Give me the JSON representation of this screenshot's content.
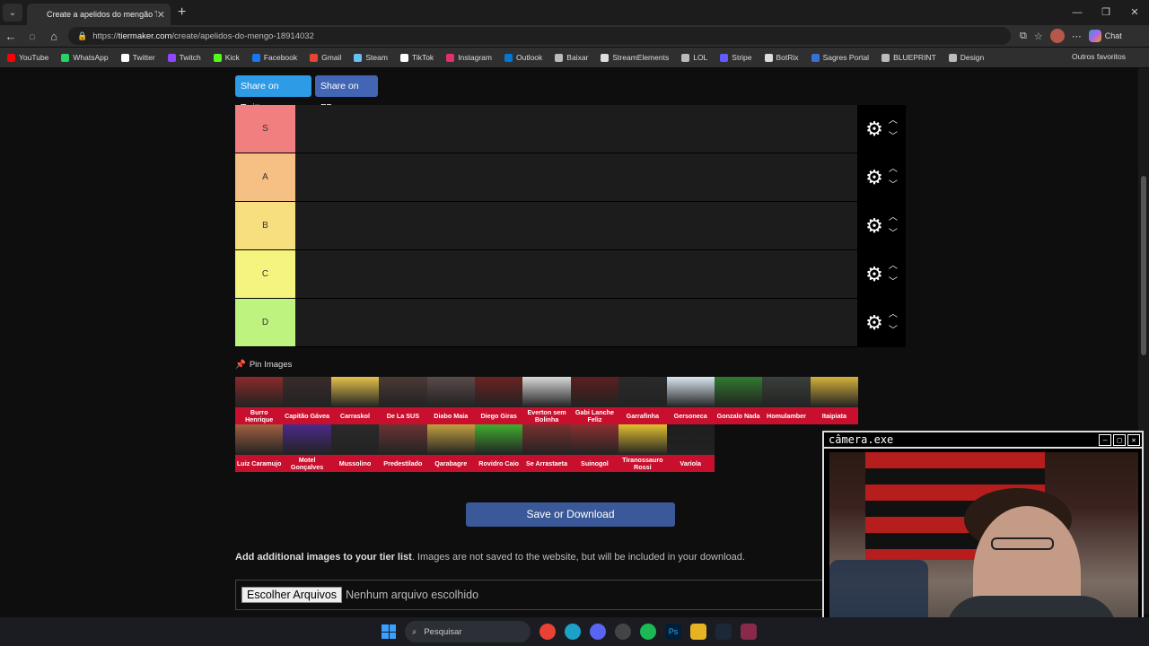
{
  "browser": {
    "tab_title": "Create a apelidos do mengão Tier",
    "url_scheme": "https://",
    "url_host": "tiermaker.com",
    "url_path": "/create/apelidos-do-mengo-18914032",
    "chat_label": "Chat"
  },
  "bookmarks": [
    {
      "label": "YouTube",
      "color": "#ff0000"
    },
    {
      "label": "WhatsApp",
      "color": "#25d366"
    },
    {
      "label": "Twitter",
      "color": "#ffffff"
    },
    {
      "label": "Twitch",
      "color": "#9146ff"
    },
    {
      "label": "Kick",
      "color": "#53fc18"
    },
    {
      "label": "Facebook",
      "color": "#1877f2"
    },
    {
      "label": "Gmail",
      "color": "#ea4335"
    },
    {
      "label": "Steam",
      "color": "#66c0f4"
    },
    {
      "label": "TikTok",
      "color": "#ffffff"
    },
    {
      "label": "Instagram",
      "color": "#e1306c"
    },
    {
      "label": "Outlook",
      "color": "#0078d4"
    },
    {
      "label": "Baixar",
      "color": "#bbbbbb"
    },
    {
      "label": "StreamElements",
      "color": "#dddddd"
    },
    {
      "label": "LOL",
      "color": "#bbbbbb"
    },
    {
      "label": "Stripe",
      "color": "#635bff"
    },
    {
      "label": "BotRix",
      "color": "#dddddd"
    },
    {
      "label": "Sagres Portal",
      "color": "#3a6fd8"
    },
    {
      "label": "BLUEPRINT",
      "color": "#bbbbbb"
    },
    {
      "label": "Design",
      "color": "#bbbbbb"
    }
  ],
  "bookmarks_other": "Outros favoritos",
  "share": {
    "twitter": "Share on Twitter",
    "facebook": "Share on FB"
  },
  "tiers": [
    {
      "label": "S",
      "color": "#f27f7f"
    },
    {
      "label": "A",
      "color": "#f6bf83"
    },
    {
      "label": "B",
      "color": "#f7df80"
    },
    {
      "label": "C",
      "color": "#f5f47f"
    },
    {
      "label": "D",
      "color": "#bff37f"
    }
  ],
  "pin_label": "Pin Images",
  "images": [
    {
      "name": "Burro Henrique",
      "color": "#8a2a2a"
    },
    {
      "name": "Capitão Gávea",
      "color": "#3a2b2b"
    },
    {
      "name": "Carraskol",
      "color": "#e3c24a"
    },
    {
      "name": "De La SUS",
      "color": "#4a3a36"
    },
    {
      "name": "Diabo Maia",
      "color": "#5a4a4a"
    },
    {
      "name": "Diego Giras",
      "color": "#6b2222"
    },
    {
      "name": "Everton sem Bolinha",
      "color": "#d8d8d8"
    },
    {
      "name": "Gabi Lanche Feliz",
      "color": "#5b1f1f"
    },
    {
      "name": "Garrafinha",
      "color": "#2a2a2a"
    },
    {
      "name": "Gersoneca",
      "color": "#d9e6f0"
    },
    {
      "name": "Gonzalo Nada",
      "color": "#2f7a2f"
    },
    {
      "name": "Homulamber",
      "color": "#3a3f3a"
    },
    {
      "name": "Itaipiata",
      "color": "#d4b13a"
    },
    {
      "name": "Luiz Caramujo",
      "color": "#a06040"
    },
    {
      "name": "Motel Gonçalves",
      "color": "#4a2a8a"
    },
    {
      "name": "Mussolino",
      "color": "#2a2a2a"
    },
    {
      "name": "Predestilado",
      "color": "#6a3434"
    },
    {
      "name": "Qarabagre",
      "color": "#c2a040"
    },
    {
      "name": "Rovidro Caio",
      "color": "#3fae2f"
    },
    {
      "name": "Se Arrastaeta",
      "color": "#7a3030"
    },
    {
      "name": "Suinogol",
      "color": "#8a3030"
    },
    {
      "name": "Tiranossauro Rossi",
      "color": "#e0c030"
    },
    {
      "name": "Varíola",
      "color": "#1e1e1e"
    }
  ],
  "save_label": "Save or Download",
  "addimg": {
    "bold": "Add additional images to your tier list",
    "rest": ". Images are not saved to the website, but will be included in your download."
  },
  "file": {
    "button": "Escolher Arquivos",
    "status": "Nenhum arquivo escolhido"
  },
  "camera_title": "câmera.exe",
  "taskbar": {
    "search": "Pesquisar"
  }
}
